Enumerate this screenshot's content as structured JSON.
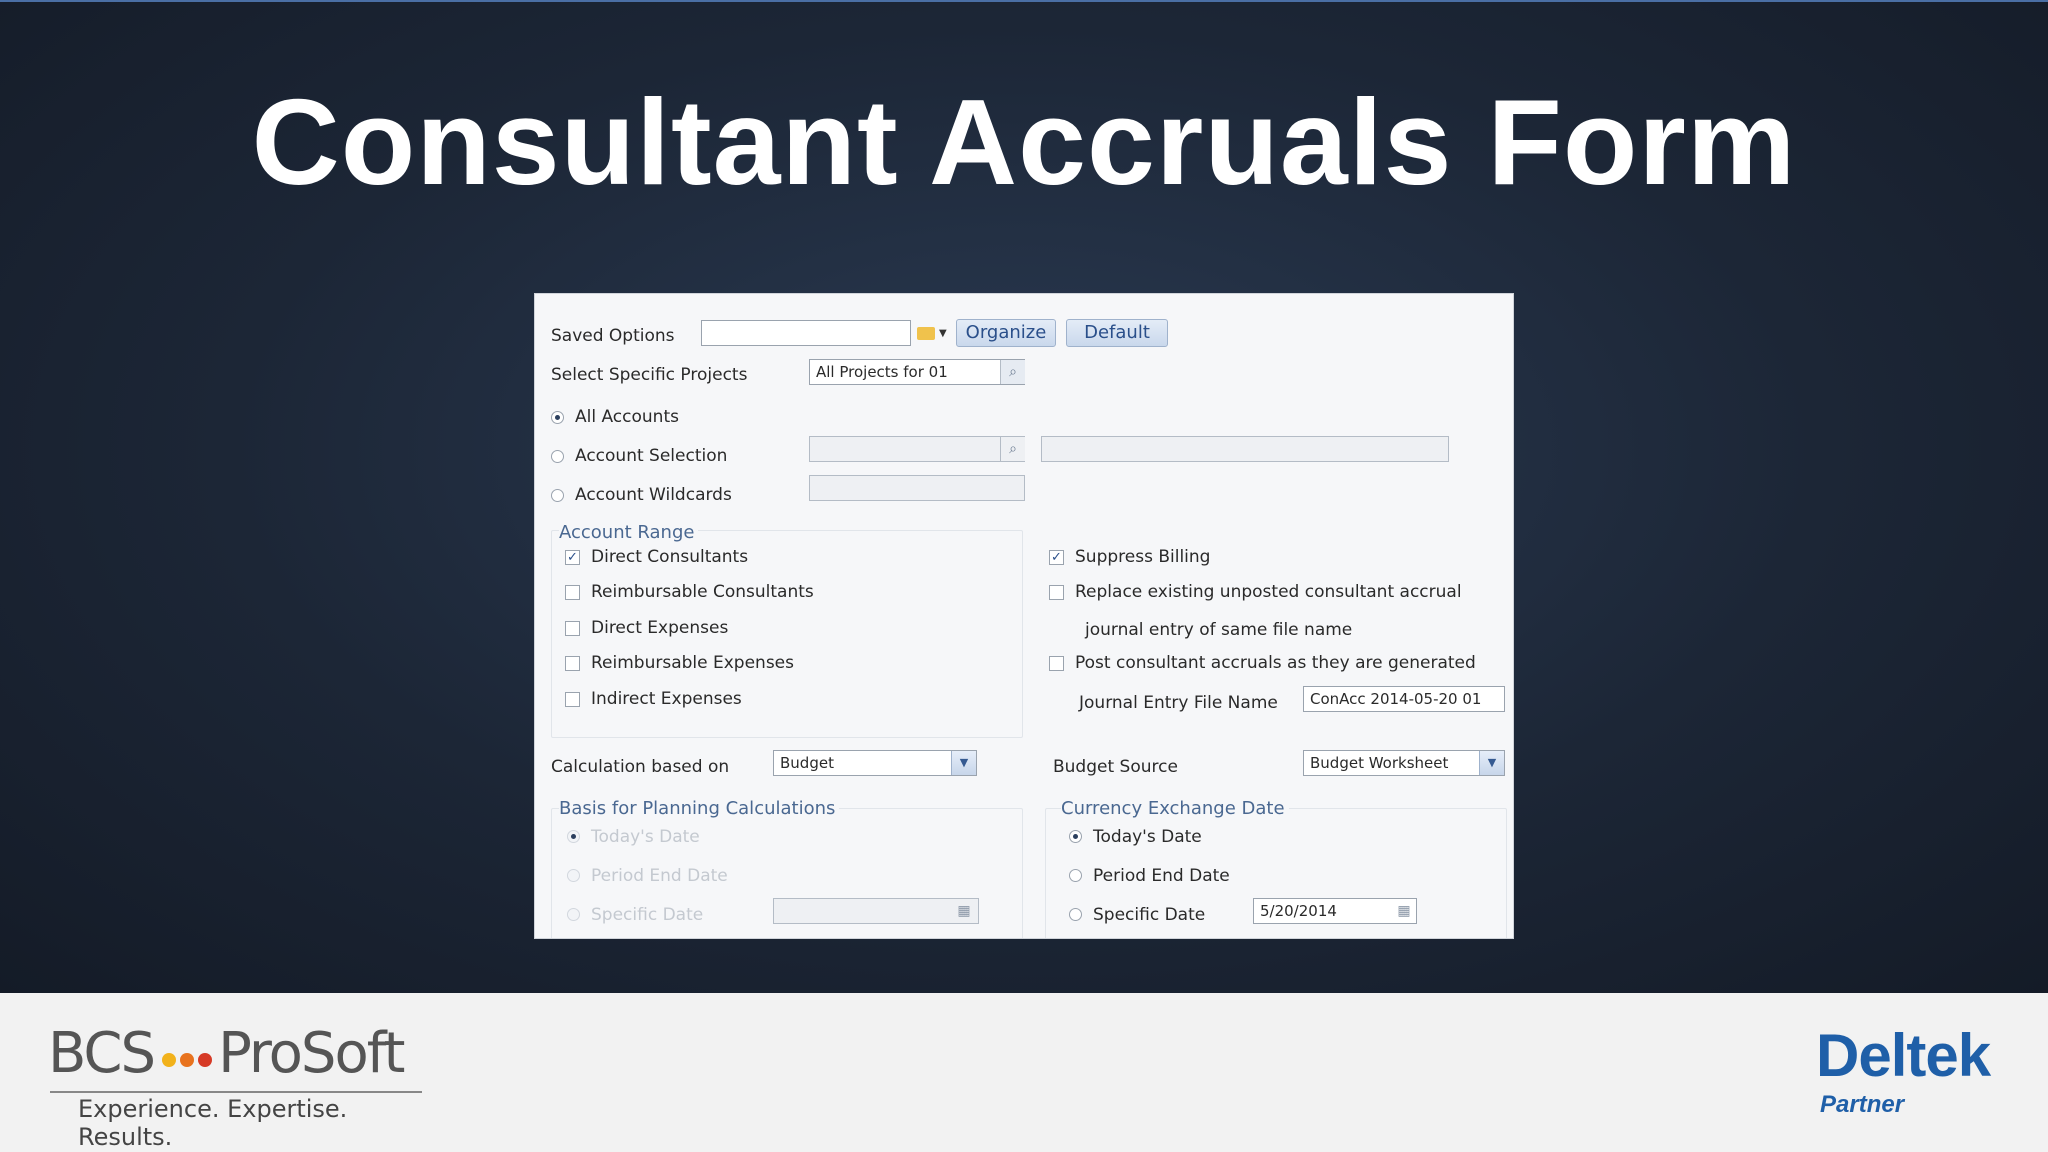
{
  "slide": {
    "title": "Consultant Accruals Form"
  },
  "footer": {
    "bcs_name_left": "BCS",
    "bcs_name_right": "ProSoft",
    "bcs_tagline": "Experience. Expertise. Results.",
    "deltek_name": "Deltek",
    "deltek_partner": "Partner",
    "dot_colors": [
      "#f2b21b",
      "#e8731e",
      "#d63a26"
    ]
  },
  "form": {
    "saved_options_label": "Saved Options",
    "saved_options_value": "",
    "organize_label": "Organize",
    "default_label": "Default",
    "select_projects_label": "Select Specific Projects",
    "select_projects_value": "All Projects for 01",
    "account_mode": {
      "all_accounts": "All Accounts",
      "account_selection": "Account Selection",
      "account_wildcards": "Account Wildcards",
      "selected": "all_accounts"
    },
    "account_range": {
      "title": "Account Range",
      "items": [
        {
          "label": "Direct Consultants",
          "checked": true
        },
        {
          "label": "Reimbursable Consultants",
          "checked": false
        },
        {
          "label": "Direct Expenses",
          "checked": false
        },
        {
          "label": "Reimbursable Expenses",
          "checked": false
        },
        {
          "label": "Indirect Expenses",
          "checked": false
        }
      ]
    },
    "options": {
      "suppress_billing": "Suppress Billing",
      "suppress_billing_checked": true,
      "replace_existing_line1": "Replace existing unposted consultant accrual",
      "replace_existing_line2": "journal entry of same file name",
      "replace_existing_checked": false,
      "post_accruals": "Post consultant accruals as they are generated",
      "post_accruals_checked": false,
      "je_file_name_label": "Journal Entry File Name",
      "je_file_name_value": "ConAcc 2014-05-20 01"
    },
    "calc_based_on_label": "Calculation based on",
    "calc_based_on_value": "Budget",
    "budget_source_label": "Budget Source",
    "budget_source_value": "Budget Worksheet",
    "basis_planning": {
      "title": "Basis for Planning Calculations",
      "todays_date": "Today's Date",
      "period_end_date": "Period End Date",
      "specific_date": "Specific Date"
    },
    "currency_exchange": {
      "title": "Currency Exchange Date",
      "todays_date": "Today's Date",
      "period_end_date": "Period End Date",
      "specific_date": "Specific Date",
      "specific_date_value": "5/20/2014",
      "selected": "todays_date"
    }
  }
}
